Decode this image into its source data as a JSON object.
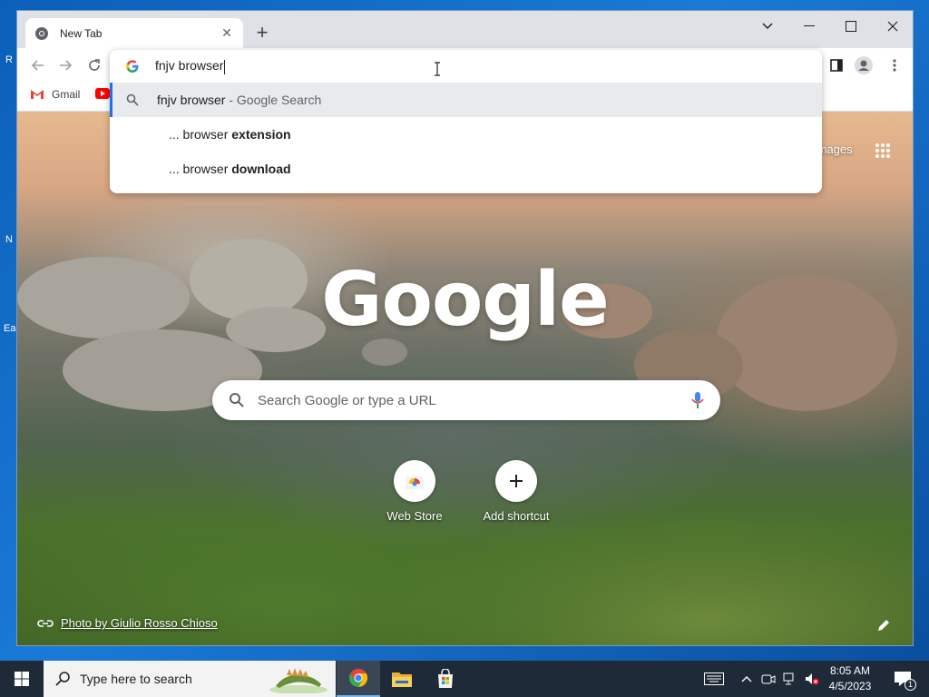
{
  "desktop": {
    "fragments": [
      "R",
      "N",
      "Ea"
    ]
  },
  "browser": {
    "tab": {
      "title": "New Tab"
    },
    "bookmarks": [
      {
        "label": "Gmail",
        "icon": "gmail-icon"
      },
      {
        "label": "",
        "icon": "youtube-icon"
      }
    ],
    "omnibox": {
      "input": "fnjv browser",
      "suggestions": [
        {
          "main": "fnjv browser",
          "suffix": " - Google Search",
          "icon": "search-icon",
          "selected": true
        },
        {
          "prefix": "... browser ",
          "bold": "extension",
          "icon": ""
        },
        {
          "prefix": "... browser ",
          "bold": "download",
          "icon": ""
        }
      ]
    },
    "page": {
      "images_link": "Images",
      "search_placeholder": "Search Google or type a URL",
      "shortcuts": [
        {
          "label": "Web Store",
          "icon": "web-store-icon"
        },
        {
          "label": "Add shortcut",
          "icon": "plus-icon"
        }
      ],
      "photo_credit": "Photo by Giulio Rosso Chioso",
      "logo_text": "Google"
    }
  },
  "taskbar": {
    "search_placeholder": "Type here to search",
    "apps": [
      "chrome-icon",
      "file-explorer-icon",
      "store-icon"
    ],
    "clock": {
      "time": "8:05 AM",
      "date": "4/5/2023"
    },
    "notification_count": "1"
  },
  "colors": {
    "accent": "#1a73e8",
    "taskbar": "#1f2a38",
    "tab_bg": "#dee1e6"
  }
}
